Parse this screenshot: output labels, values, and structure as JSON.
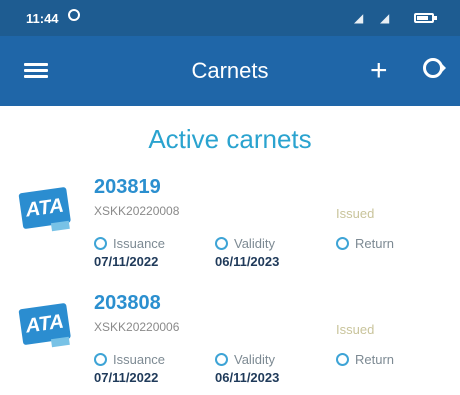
{
  "status_bar": {
    "time": "11:44",
    "icons": [
      "alarm-icon",
      "signal-icon",
      "signal-icon",
      "battery-icon"
    ],
    "battery_level": 0.75
  },
  "app_bar": {
    "title": "Carnets",
    "icons": [
      "menu-icon",
      "add-icon",
      "refresh-icon"
    ]
  },
  "section": {
    "title": "Active carnets"
  },
  "carnets": [
    {
      "number": "203819",
      "reference": "XSKK20220008",
      "status": "Issued",
      "issuance_label": "Issuance",
      "issuance_date": "07/11/2022",
      "validity_label": "Validity",
      "validity_date": "06/11/2023",
      "return_label": "Return"
    },
    {
      "number": "203808",
      "reference": "XSKK20220006",
      "status": "Issued",
      "issuance_label": "Issuance",
      "issuance_date": "07/11/2022",
      "validity_label": "Validity",
      "validity_date": "06/11/2023",
      "return_label": "Return"
    }
  ],
  "logo_text": "ATA",
  "colors": {
    "status_bar": "#1e5c91",
    "app_bar": "#1f66a8",
    "accent": "#2aa3cf",
    "issued": "#c9c49b"
  }
}
